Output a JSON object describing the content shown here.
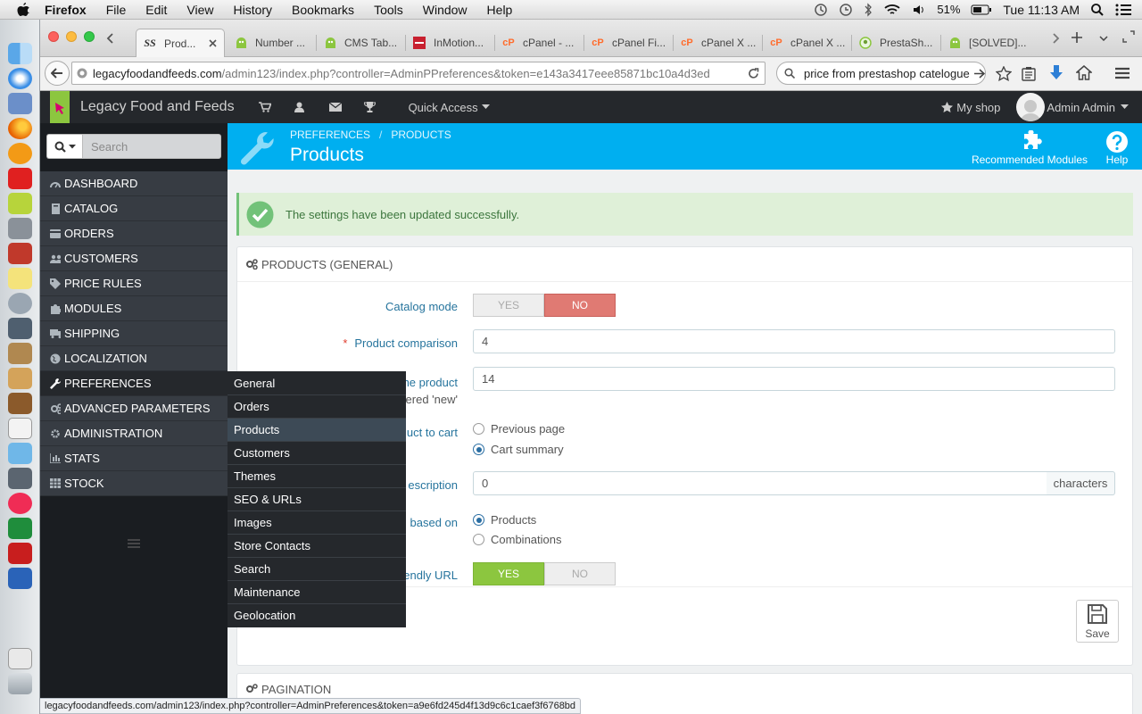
{
  "os_menubar": {
    "app": "Firefox",
    "menus": [
      "File",
      "Edit",
      "View",
      "History",
      "Bookmarks",
      "Tools",
      "Window",
      "Help"
    ],
    "battery": "51%",
    "clock": "Tue 11:13 AM"
  },
  "tabs": [
    {
      "label": "Prod...",
      "icon": "ss-icon",
      "active": true
    },
    {
      "label": "Number ...",
      "icon": "prestashop-icon"
    },
    {
      "label": "CMS Tab...",
      "icon": "prestashop-icon"
    },
    {
      "label": "InMotion...",
      "icon": "inmotion-icon"
    },
    {
      "label": "cPanel - ...",
      "icon": "cpanel-icon"
    },
    {
      "label": "cPanel Fi...",
      "icon": "cpanel-icon"
    },
    {
      "label": "cPanel X ...",
      "icon": "cpanel-icon"
    },
    {
      "label": "cPanel X ...",
      "icon": "cpanel-icon"
    },
    {
      "label": "PrestaSh...",
      "icon": "prestashop-forum-icon"
    },
    {
      "label": "[SOLVED]...",
      "icon": "prestashop-icon"
    }
  ],
  "navbar": {
    "url_host": "legacyfoodandfeeds.com",
    "url_path": "/admin123/index.php?controller=AdminPPreferences&token=e143a3417eee85871bc10a4d3ed",
    "search_value": "price from prestashop catelogue"
  },
  "header": {
    "shop_name": "Legacy Food and Feeds",
    "quick_access": "Quick Access",
    "my_shop": "My shop",
    "user": "Admin Admin"
  },
  "sidebar": {
    "search_placeholder": "Search",
    "items": [
      {
        "label": "DASHBOARD",
        "icon": "dashboard-icon"
      },
      {
        "label": "CATALOG",
        "icon": "book-icon"
      },
      {
        "label": "ORDERS",
        "icon": "credit-card-icon"
      },
      {
        "label": "CUSTOMERS",
        "icon": "users-icon"
      },
      {
        "label": "PRICE RULES",
        "icon": "tag-icon"
      },
      {
        "label": "MODULES",
        "icon": "puzzle-icon"
      },
      {
        "label": "SHIPPING",
        "icon": "truck-icon"
      },
      {
        "label": "LOCALIZATION",
        "icon": "globe-icon"
      },
      {
        "label": "PREFERENCES",
        "icon": "wrench-icon",
        "active": true
      },
      {
        "label": "ADVANCED PARAMETERS",
        "icon": "cogs-icon"
      },
      {
        "label": "ADMINISTRATION",
        "icon": "cog-icon"
      },
      {
        "label": "STATS",
        "icon": "bar-chart-icon"
      },
      {
        "label": "STOCK",
        "icon": "grid-icon"
      }
    ],
    "submenu": [
      "General",
      "Orders",
      "Products",
      "Customers",
      "Themes",
      "SEO & URLs",
      "Images",
      "Store Contacts",
      "Search",
      "Maintenance",
      "Geolocation"
    ],
    "submenu_active": "Products"
  },
  "page": {
    "breadcrumb": [
      "PREFERENCES",
      "PRODUCTS"
    ],
    "title": "Products",
    "recommended_modules": "Recommended Modules",
    "help": "Help",
    "success_message": "The settings have been updated successfully."
  },
  "form": {
    "panel_title": "PRODUCTS (GENERAL)",
    "catalog_mode": {
      "label": "Catalog mode",
      "yes": "YES",
      "no": "NO",
      "value": "NO"
    },
    "product_comparison": {
      "required_mark": "*",
      "label": "Product comparison",
      "value": "4"
    },
    "new_days": {
      "label_line1": "he product",
      "label_line2": "ered 'new'",
      "value": "14"
    },
    "redirect": {
      "label": "uct to cart",
      "options": [
        "Previous page",
        "Cart summary"
      ],
      "selected": "Cart summary"
    },
    "short_description": {
      "label": "escription",
      "value": "0",
      "addon": "characters"
    },
    "quantity_based": {
      "label": "based on",
      "options": [
        "Products",
        "Combinations"
      ],
      "selected": "Products"
    },
    "friendly_url": {
      "label": "endly URL",
      "yes": "YES",
      "no": "NO",
      "value": "YES"
    },
    "save_label": "Save",
    "next_panel_title": "PAGINATION"
  },
  "statusbar": "legacyfoodandfeeds.com/admin123/index.php?controller=AdminPreferences&token=a9e6fd245d4f13d9c6c1caef3f6768bd",
  "colors": {
    "accent": "#00aff0",
    "success_bg": "#dff0d8",
    "toggle_no": "#e07a73",
    "toggle_yes": "#8cc63f"
  }
}
